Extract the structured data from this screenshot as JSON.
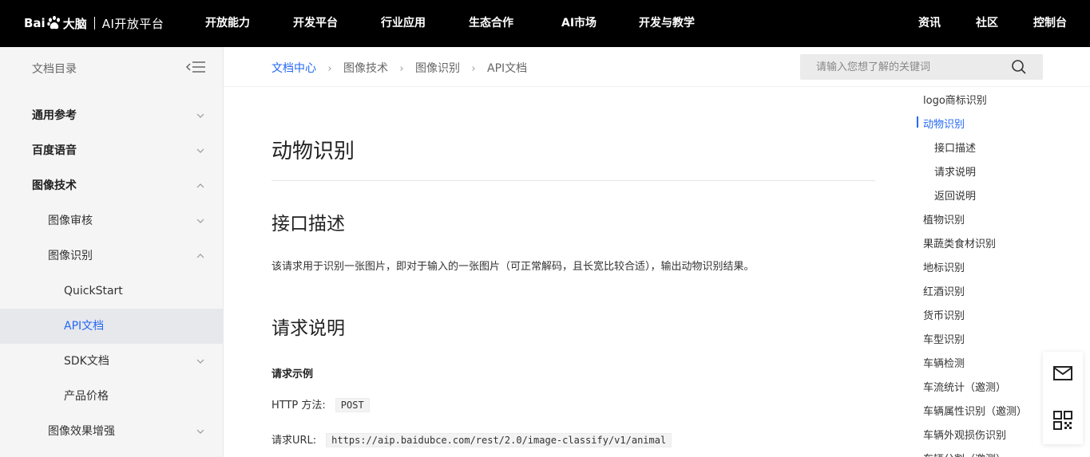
{
  "topnav": {
    "logo_text": "Bai",
    "logo_text2": "大脑",
    "logo_sub": "AI开放平台",
    "items": [
      "开放能力",
      "开发平台",
      "行业应用",
      "生态合作",
      "AI市场",
      "开发与教学"
    ],
    "right_items": [
      "资讯",
      "社区",
      "控制台"
    ]
  },
  "sidebar": {
    "title": "文档目录",
    "items": [
      {
        "label": "通用参考",
        "level": 1,
        "expanded": false
      },
      {
        "label": "百度语音",
        "level": 1,
        "expanded": false
      },
      {
        "label": "图像技术",
        "level": 1,
        "expanded": true
      },
      {
        "label": "图像审核",
        "level": 2,
        "expanded": false
      },
      {
        "label": "图像识别",
        "level": 2,
        "expanded": true
      },
      {
        "label": "QuickStart",
        "level": 3
      },
      {
        "label": "API文档",
        "level": 3,
        "active": true
      },
      {
        "label": "SDK文档",
        "level": 3,
        "expanded": false
      },
      {
        "label": "产品价格",
        "level": 3
      },
      {
        "label": "图像效果增强",
        "level": 2,
        "expanded": false
      }
    ]
  },
  "breadcrumb": [
    "文档中心",
    "图像技术",
    "图像识别",
    "API文档"
  ],
  "search": {
    "placeholder": "请输入您想了解的关键词"
  },
  "main": {
    "title": "动物识别",
    "section1": "接口描述",
    "description": "该请求用于识别一张图片，即对于输入的一张图片（可正常解码，且长宽比较合适），输出动物识别结果。",
    "section2": "请求说明",
    "example_heading": "请求示例",
    "http_method_label": "HTTP 方法:",
    "http_method_value": "POST",
    "url_label": "请求URL:",
    "url_value": "https://aip.baidubce.com/rest/2.0/image-classify/v1/animal"
  },
  "toc": {
    "items": [
      {
        "label": "logo商标识别"
      },
      {
        "label": "动物识别",
        "active": true
      },
      {
        "label": "接口描述",
        "sub": true
      },
      {
        "label": "请求说明",
        "sub": true
      },
      {
        "label": "返回说明",
        "sub": true
      },
      {
        "label": "植物识别"
      },
      {
        "label": "果蔬类食材识别"
      },
      {
        "label": "地标识别"
      },
      {
        "label": "红酒识别"
      },
      {
        "label": "货币识别"
      },
      {
        "label": "车型识别"
      },
      {
        "label": "车辆检测"
      },
      {
        "label": "车流统计（邀测）"
      },
      {
        "label": "车辆属性识别（邀测）"
      },
      {
        "label": "车辆外观损伤识别"
      },
      {
        "label": "车辆分割（邀测）"
      }
    ]
  },
  "float_panel": {
    "icons": [
      "mail-icon",
      "qrcode-icon"
    ]
  },
  "colors": {
    "accent": "#2468f2",
    "nav_bg": "#000000",
    "sidebar_bg": "#f5f5f5"
  }
}
